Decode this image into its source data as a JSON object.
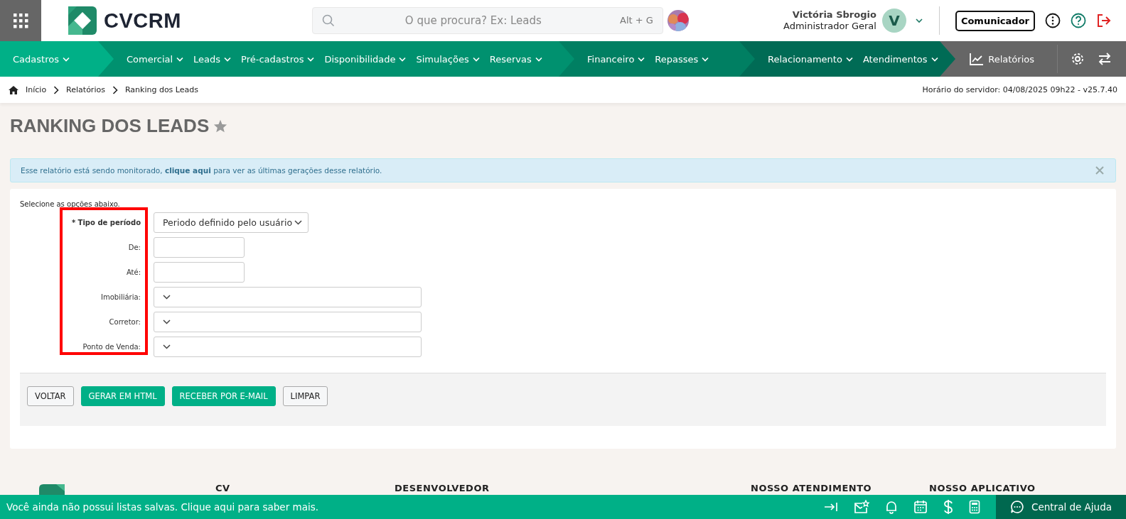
{
  "header": {
    "logo": "CVCRM",
    "search": {
      "placeholder": "O que procura? Ex: Leads",
      "shortcut": "Alt + G"
    },
    "user": {
      "name": "Victória Sbrogio",
      "role": "Administrador Geral",
      "initial": "V"
    },
    "communicator_button": "Comunicador"
  },
  "nav": {
    "groups": [
      {
        "items": [
          "Cadastros"
        ]
      },
      {
        "items": [
          "Comercial",
          "Leads",
          "Pré-cadastros",
          "Disponibilidade",
          "Simulações",
          "Reservas"
        ]
      },
      {
        "items": [
          "Financeiro",
          "Repasses"
        ]
      },
      {
        "items": [
          "Relacionamento",
          "Atendimentos"
        ]
      }
    ],
    "reports": "Relatórios"
  },
  "breadcrumb": [
    "Início",
    "Relatórios",
    "Ranking dos Leads"
  ],
  "server_time": "Horário do servidor: 04/08/2025 09h22 - v25.7.40",
  "page_title": "RANKING DOS LEADS",
  "alert": {
    "before": "Esse relatório está sendo monitorado, ",
    "link": "clique aqui",
    "after": " para ver as últimas gerações desse relatório."
  },
  "form": {
    "intro": "Selecione as opções abaixo.",
    "fields": [
      {
        "label": "* Tipo de período",
        "kind": "select",
        "value": "Periodo definido pelo usuário",
        "required": true
      },
      {
        "label": "De:",
        "kind": "text",
        "required": false
      },
      {
        "label": "Até:",
        "kind": "text",
        "required": false
      },
      {
        "label": "Imobiliária:",
        "kind": "select",
        "required": false
      },
      {
        "label": "Corretor:",
        "kind": "select",
        "required": false
      },
      {
        "label": "Ponto de Venda:",
        "kind": "select",
        "required": false
      }
    ],
    "buttons": [
      {
        "label": "VOLTAR",
        "kind": "default"
      },
      {
        "label": "GERAR EM HTML",
        "kind": "primary"
      },
      {
        "label": "RECEBER POR E-MAIL",
        "kind": "primary"
      },
      {
        "label": "LIMPAR",
        "kind": "default"
      }
    ]
  },
  "footer_headings": [
    "CV",
    "DESENVOLVEDOR",
    "NOSSO ATENDIMENTO",
    "NOSSO APLICATIVO"
  ],
  "bottom_bar": {
    "message": "Você ainda não possui listas salvas. Clique aqui para saber mais.",
    "help": "Central de Ajuda"
  }
}
